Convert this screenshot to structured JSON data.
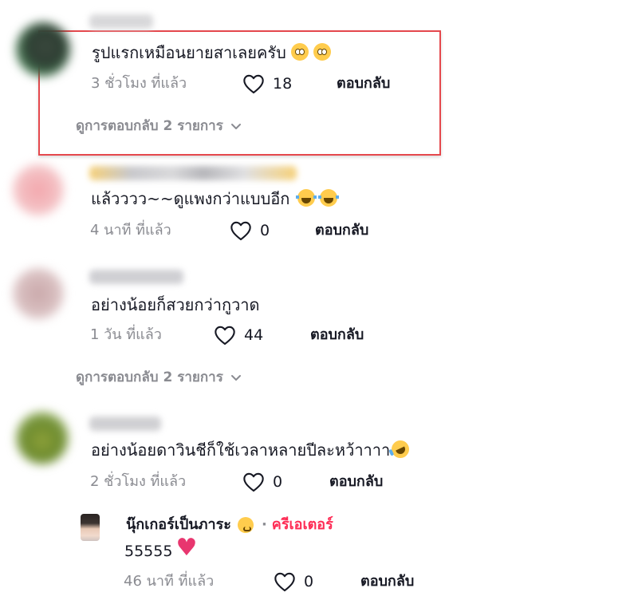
{
  "comments": [
    {
      "text": "รูปแรกเหมือนยายสาเลยครับ",
      "emojis": [
        "slightly-smiling-face",
        "slightly-smiling-face"
      ],
      "time": "3 ชั่วโมง ที่แล้ว",
      "likes": "18",
      "reply_label": "ตอบกลับ",
      "view_replies": "ดูการตอบกลับ 2 รายการ"
    },
    {
      "text": "แล้วววว~~ดูแพงกว่าแบบอีก",
      "emojis": [
        "face-with-tears-of-joy",
        "face-with-tears-of-joy"
      ],
      "time": "4 นาที ที่แล้ว",
      "likes": "0",
      "reply_label": "ตอบกลับ"
    },
    {
      "text": "อย่างน้อยก็สวยกว่ากูวาด",
      "time": "1 วัน ที่แล้ว",
      "likes": "44",
      "reply_label": "ตอบกลับ",
      "view_replies": "ดูการตอบกลับ 2 รายการ"
    },
    {
      "text": "อย่างน้อยดาวินชีก็ใช้เวลาหลายปีละหว้าาาา",
      "emojis": [
        "rolling-on-the-floor-laughing"
      ],
      "time": "2 ชั่วโมง ที่แล้ว",
      "likes": "0",
      "reply_label": "ตอบกลับ"
    }
  ],
  "reply": {
    "username": "นุ๊กเกอร์เป็นภาระ",
    "username_emoji": "kissing-face-with-smiling-eyes",
    "separator": "·",
    "creator_badge": "ครีเอเตอร์",
    "text": "55555",
    "text_emoji": "red-heart",
    "time": "46 นาที ที่แล้ว",
    "likes": "0",
    "reply_label": "ตอบกลับ"
  },
  "colors": {
    "highlight_border": "#e5484d",
    "creator": "#fe2c55",
    "muted": "#8a8b91",
    "text": "#161823"
  }
}
